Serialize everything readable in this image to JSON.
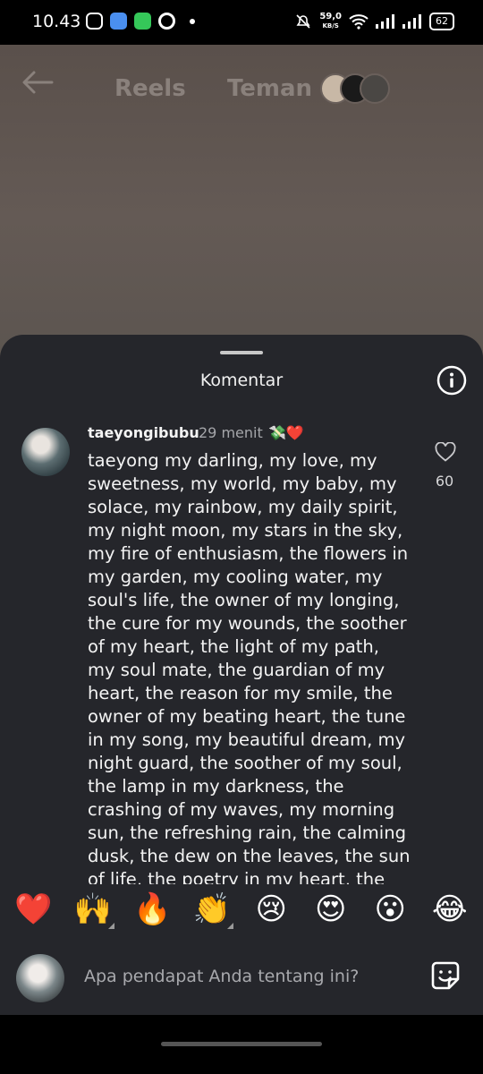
{
  "status_bar": {
    "time": "10.43",
    "net_speed": "59,0",
    "net_unit": "KB/S",
    "battery": "62"
  },
  "header": {
    "tabs": [
      {
        "label": "Reels"
      },
      {
        "label": "Teman"
      }
    ]
  },
  "sheet": {
    "title": "Komentar"
  },
  "comment": {
    "username": "taeyongibubu",
    "time": "29 menit",
    "sticker": "💸❤️",
    "text": "taeyong my darling, my love, my sweetness, my world, my baby, my solace, my rainbow, my daily spirit, my night moon, my stars in the sky, my fire of enthusiasm, the flowers in my garden, my cooling water, my soul's life, the owner of my longing, the cure for my wounds, the soother of my heart, the light of my path, my soul mate, the guardian of my heart, the reason for my smile, the owner of my beating heart, the tune in my song, my beautiful dream, my night guard, the soother of my soul, the lamp in my darkness, the crashing of my waves, my morning sun, the refreshing rain, the calming dusk, the dew on the leaves, the sun of life, the poetry in my heart, the",
    "likes": "60"
  },
  "reactions": [
    "❤️",
    "🙌",
    "🔥",
    "👏",
    "😢",
    "😍",
    "😮",
    "😂"
  ],
  "composer": {
    "placeholder": "Apa pendapat Anda tentang ini?"
  }
}
